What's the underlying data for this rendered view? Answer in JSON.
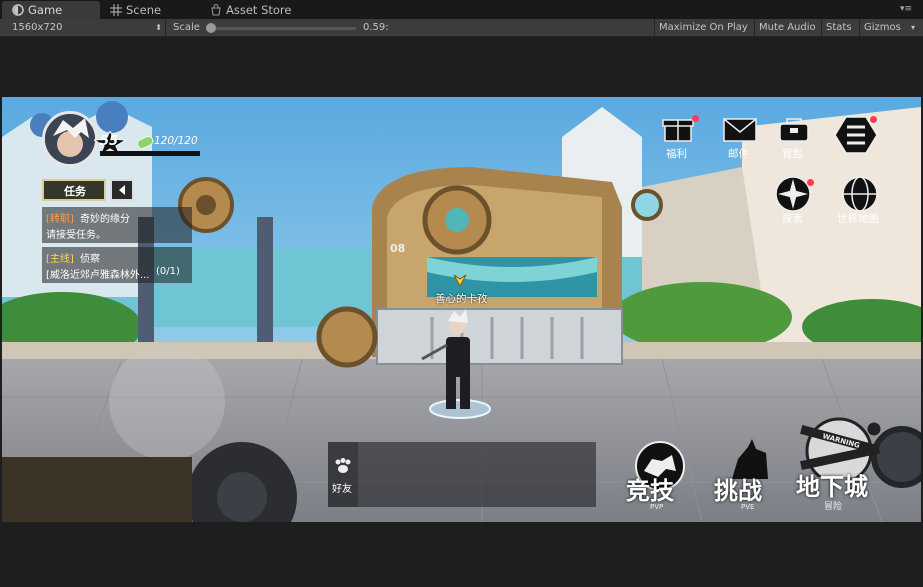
{
  "tabs": [
    {
      "label": "Game",
      "icon": "game-controller-icon"
    },
    {
      "label": "Scene",
      "icon": "grid-icon"
    },
    {
      "label": "Asset Store",
      "icon": "bag-icon"
    }
  ],
  "toolbar": {
    "resolution": "1560x720",
    "scale_label": "Scale",
    "scale_value": "0.59:",
    "maximize_on_play": "Maximize On Play",
    "mute_audio": "Mute Audio",
    "stats": "Stats",
    "gizmos": "Gizmos"
  },
  "game": {
    "player": {
      "level": "55",
      "energy": "120/120"
    },
    "quest": {
      "tab_label": "任务",
      "items": [
        {
          "tag": "[转职]",
          "title": "奇妙的缘分",
          "desc": "请接受任务。"
        },
        {
          "tag": "[主线]",
          "title": "侦察",
          "desc": "[威洛近郊卢雅森林外...",
          "progress": "(0/1)"
        }
      ]
    },
    "top_menu": [
      {
        "label": "福利",
        "icon": "gift-icon"
      },
      {
        "label": "邮件",
        "icon": "mail-icon"
      },
      {
        "label": "背包",
        "icon": "backpack-icon"
      },
      {
        "label": "",
        "icon": "hamburger-menu-icon"
      }
    ],
    "side_menu": [
      {
        "label": "探索",
        "icon": "compass-icon"
      },
      {
        "label": "世界地图",
        "icon": "globe-icon"
      }
    ],
    "npc_label": "善心的卡孜",
    "machine_number": "08",
    "friends_label": "好友",
    "modes": [
      {
        "label": "竞技",
        "sub": "PVP"
      },
      {
        "label": "挑战",
        "sub": "PVE"
      },
      {
        "label": "地下城",
        "sub": "冒险"
      }
    ],
    "warning_text": "WARNING"
  },
  "colors": {
    "tag_orange": "#ff9a4a",
    "tag_yellow": "#ffd84a",
    "notification": "#ff3b55"
  }
}
